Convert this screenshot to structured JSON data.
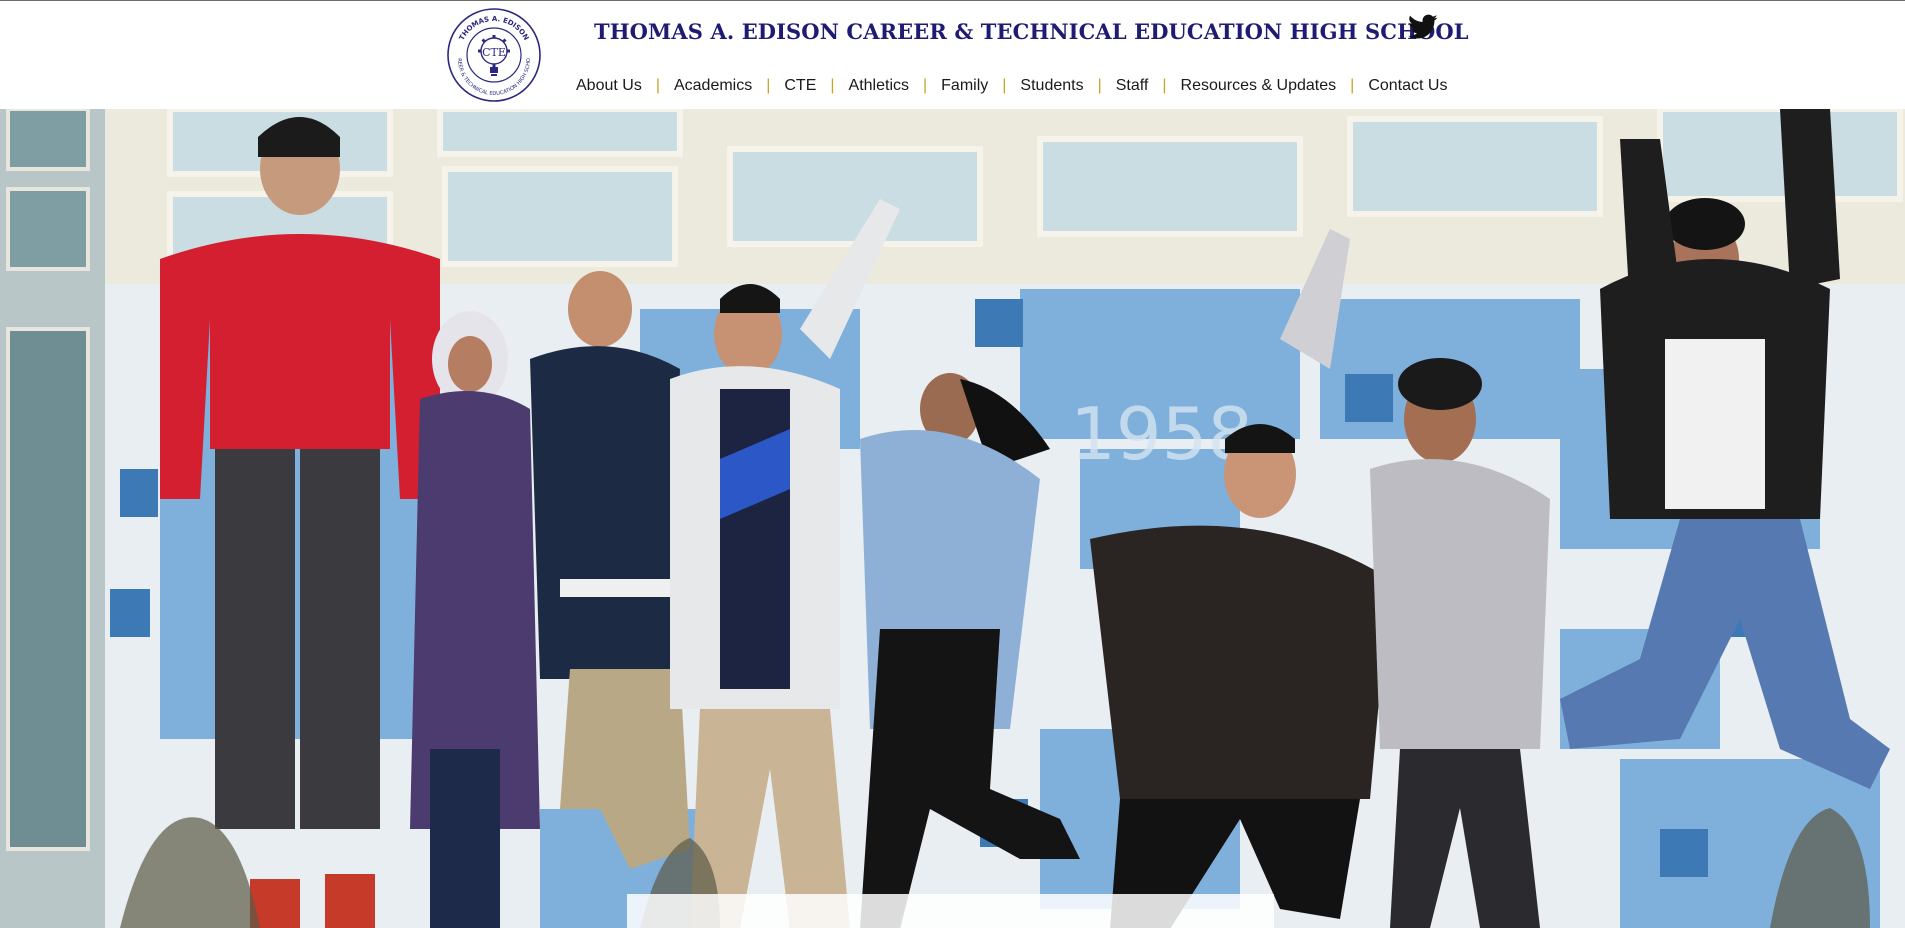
{
  "header": {
    "school_name": "THOMAS A. EDISON CAREER & TECHNICAL EDUCATION HIGH SCHOOL",
    "logo": {
      "ring_text_top": "THOMAS A. EDISON",
      "ring_text_bottom": "CAREER & TECHNICAL EDUCATION HIGH SCHOOL",
      "monogram": "CTE",
      "color": "#2a2880"
    },
    "social_icon": "twitter-icon"
  },
  "nav": {
    "items": [
      {
        "label": "About Us"
      },
      {
        "label": "Academics"
      },
      {
        "label": "CTE"
      },
      {
        "label": "Athletics"
      },
      {
        "label": "Family"
      },
      {
        "label": "Students"
      },
      {
        "label": "Staff"
      },
      {
        "label": "Resources & Updates"
      },
      {
        "label": "Contact Us"
      }
    ],
    "separator": "|"
  },
  "hero": {
    "wall_number": "1958"
  },
  "colors": {
    "title": "#1e1b72",
    "separator": "#c9a227",
    "nav_text": "#1a1a1a",
    "wall_blue": "#6fa6d6",
    "wall_light": "#e9eef2"
  }
}
